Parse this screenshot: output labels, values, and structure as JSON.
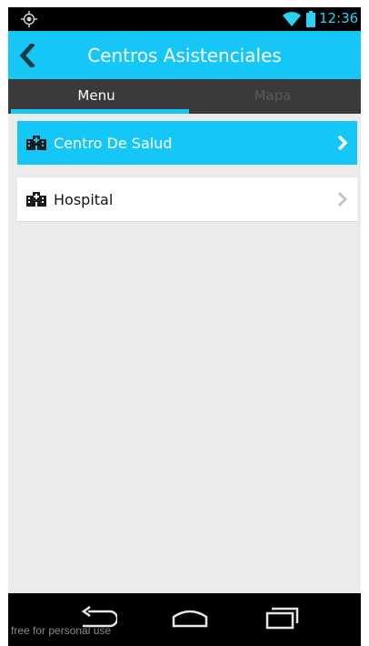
{
  "status_bar": {
    "time": "12:36",
    "left_icon": "gps-icon",
    "wifi_icon": "wifi-icon",
    "battery_icon": "battery-icon"
  },
  "app_bar": {
    "title": "Centros Asistenciales",
    "back_icon": "back-chevron-icon"
  },
  "tabs": [
    {
      "label": "Menu",
      "selected": true
    },
    {
      "label": "Mapa",
      "selected": false
    }
  ],
  "list": [
    {
      "label": "Centro De Salud",
      "icon": "hospital-building-icon",
      "active": true
    },
    {
      "label": "Hospital",
      "icon": "hospital-building-icon",
      "active": false
    }
  ],
  "nav_bar": {
    "back": "nav-back-icon",
    "home": "nav-home-icon",
    "recents": "nav-recents-icon"
  },
  "watermark": "free for personal use",
  "colors": {
    "accent": "#14c7f6",
    "tab_bar": "#3a3a3a",
    "background": "#ebebeb"
  }
}
